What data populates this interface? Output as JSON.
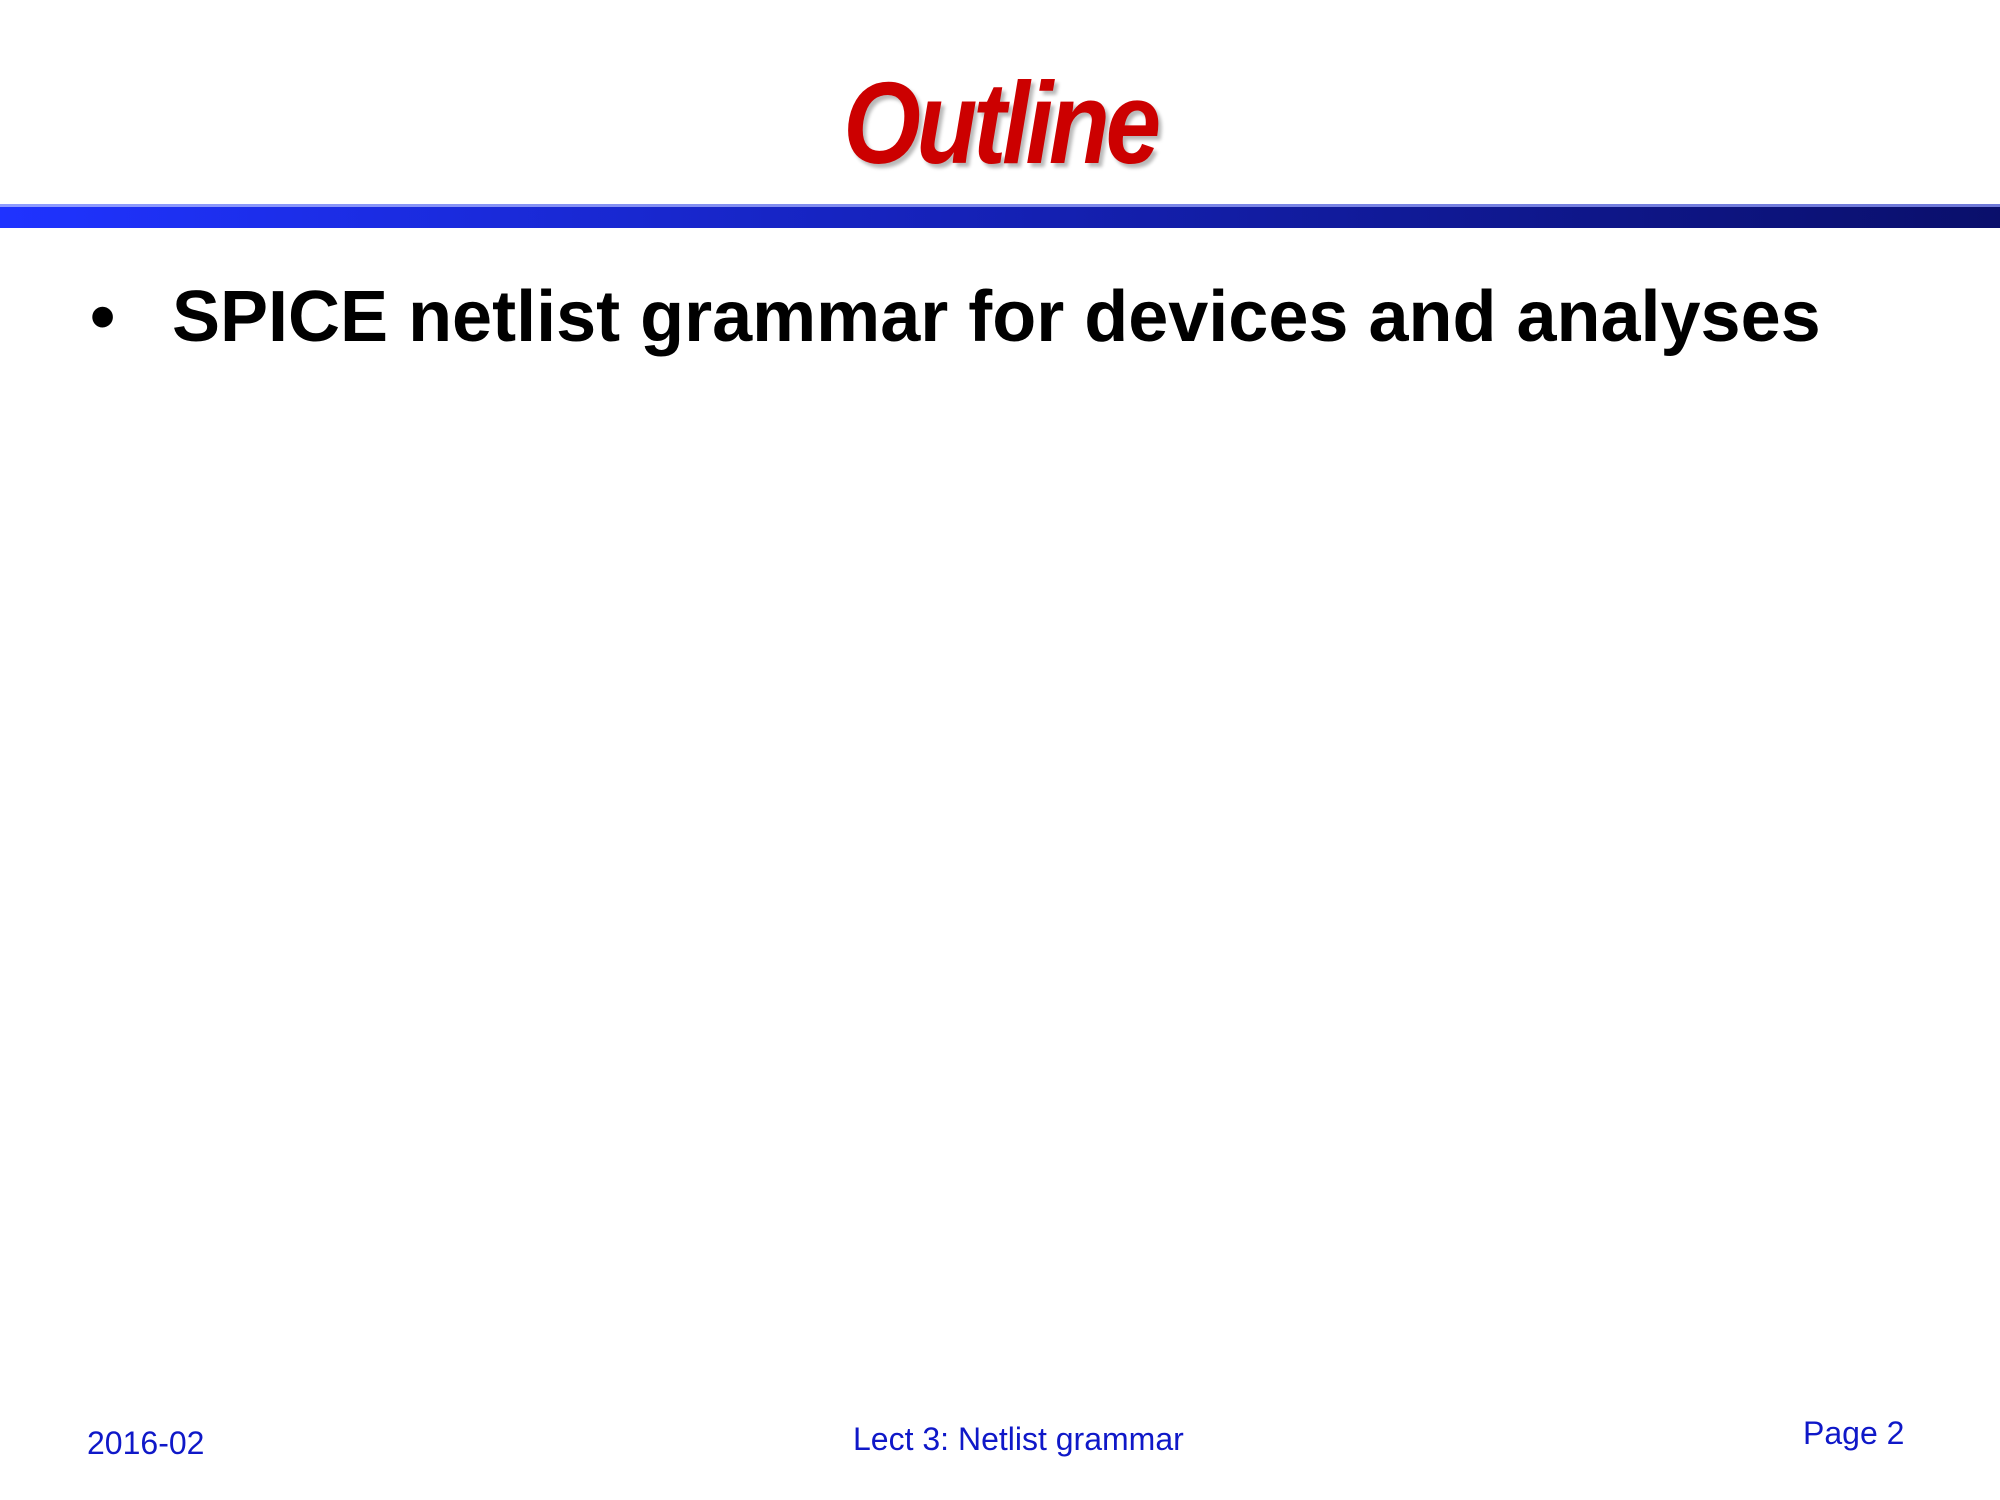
{
  "slide": {
    "title": "Outline",
    "bullets": [
      {
        "marker": "•",
        "text": "SPICE netlist grammar for devices and analyses"
      }
    ],
    "footer": {
      "date": "2016-02",
      "lecture": "Lect 3: Netlist grammar",
      "page": "Page 2"
    }
  },
  "colors": {
    "title": "#cc0000",
    "rule_start": "#1f33ff",
    "rule_end": "#0a0f6b",
    "footer_text": "#0f18c8",
    "body_text": "#000000"
  }
}
